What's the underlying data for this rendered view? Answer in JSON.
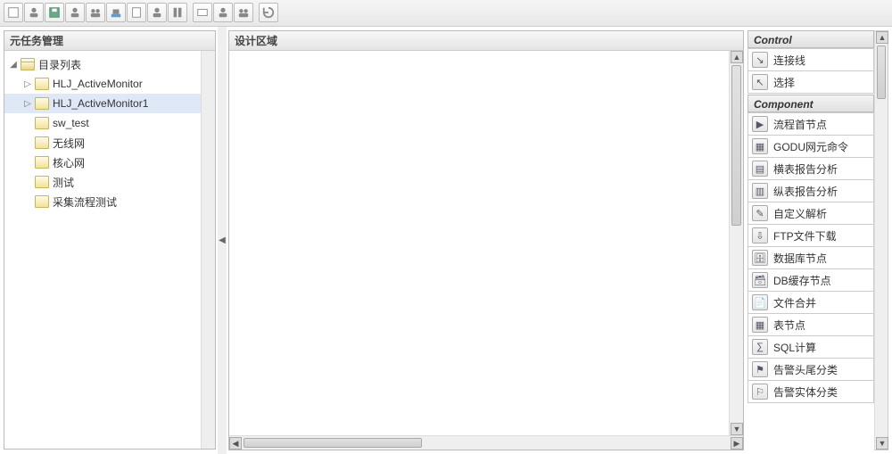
{
  "toolbar_icons": [
    "new",
    "user",
    "save",
    "user2",
    "users",
    "pool",
    "doc",
    "user3",
    "columns",
    "sep",
    "card",
    "user4",
    "users2",
    "sep",
    "refresh"
  ],
  "left": {
    "title": "元任务管理",
    "root": {
      "label": "目录列表",
      "expanded": true,
      "children": [
        {
          "label": "HLJ_ActiveMonitor",
          "expanded": false,
          "hasChildren": true,
          "selected": false
        },
        {
          "label": "HLJ_ActiveMonitor1",
          "expanded": false,
          "hasChildren": true,
          "selected": true
        },
        {
          "label": "sw_test",
          "hasChildren": false,
          "selected": false
        },
        {
          "label": "无线网",
          "hasChildren": false,
          "selected": false
        },
        {
          "label": "核心网",
          "hasChildren": false,
          "selected": false
        },
        {
          "label": "测试",
          "hasChildren": false,
          "selected": false
        },
        {
          "label": "采集流程测试",
          "hasChildren": false,
          "selected": false
        }
      ]
    }
  },
  "center": {
    "title": "设计区域"
  },
  "right": {
    "control_title": "Control",
    "controls": [
      {
        "icon": "arrow-se",
        "glyph": "↘",
        "label": "连接线"
      },
      {
        "icon": "cursor",
        "glyph": "↖",
        "label": "选择"
      }
    ],
    "component_title": "Component",
    "components": [
      {
        "icon": "play",
        "glyph": "▶",
        "label": "流程首节点"
      },
      {
        "icon": "grid",
        "glyph": "▦",
        "label": "GODU网元命令"
      },
      {
        "icon": "hrep",
        "glyph": "▤",
        "label": "横表报告分析"
      },
      {
        "icon": "vrep",
        "glyph": "▥",
        "label": "纵表报告分析"
      },
      {
        "icon": "parse",
        "glyph": "✎",
        "label": "自定义解析"
      },
      {
        "icon": "ftp",
        "glyph": "⇩",
        "label": "FTP文件下载"
      },
      {
        "icon": "db",
        "glyph": "🗄",
        "label": "数据库节点"
      },
      {
        "icon": "cache",
        "glyph": "🗃",
        "label": "DB缓存节点"
      },
      {
        "icon": "merge",
        "glyph": "📄",
        "label": "文件合并"
      },
      {
        "icon": "table",
        "glyph": "▦",
        "label": "表节点"
      },
      {
        "icon": "sql",
        "glyph": "∑",
        "label": "SQL计算"
      },
      {
        "icon": "alarm1",
        "glyph": "⚑",
        "label": "告警头尾分类"
      },
      {
        "icon": "alarm2",
        "glyph": "⚐",
        "label": "告警实体分类"
      }
    ]
  }
}
